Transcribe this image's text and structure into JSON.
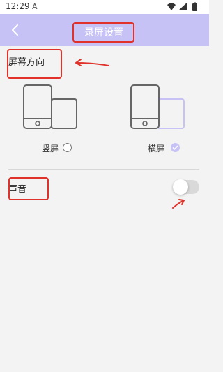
{
  "status_bar": {
    "time": "12:29",
    "notification": "A"
  },
  "header": {
    "title": "录屏设置"
  },
  "orientation": {
    "title": "屏幕方向",
    "options": [
      {
        "label": "竖屏",
        "selected": false
      },
      {
        "label": "横屏",
        "selected": true
      }
    ]
  },
  "sound": {
    "label": "声音",
    "enabled": false
  },
  "colors": {
    "accent": "#c7c2f5",
    "annotation": "#e0322a"
  }
}
